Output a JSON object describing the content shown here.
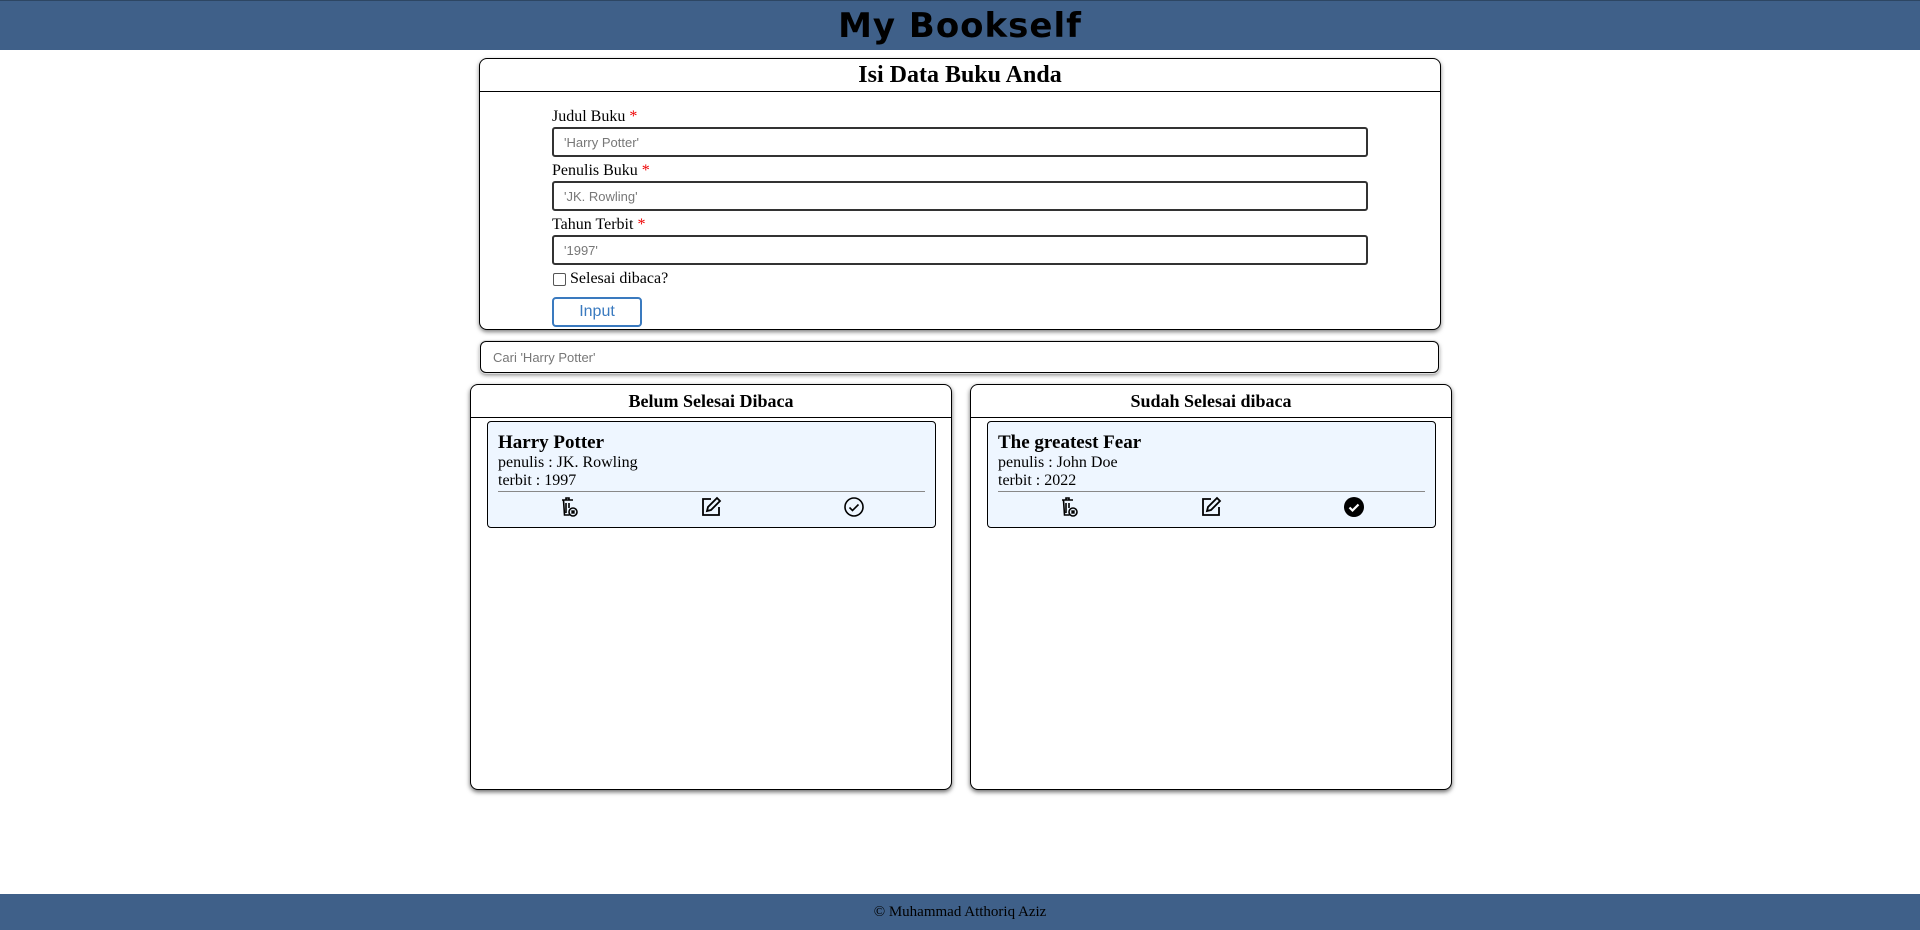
{
  "header": {
    "title": "My Bookself"
  },
  "form": {
    "title": "Isi Data Buku Anda",
    "title_field": {
      "label": "Judul Buku",
      "required_mark": "*",
      "placeholder": "'Harry Potter'"
    },
    "author_field": {
      "label": "Penulis Buku",
      "required_mark": "*",
      "placeholder": "'JK. Rowling'"
    },
    "year_field": {
      "label": "Tahun Terbit",
      "required_mark": "*",
      "placeholder": "'1997'"
    },
    "finished_checkbox": {
      "label": "Selesai dibaca?",
      "checked": false
    },
    "submit_label": "Input"
  },
  "search": {
    "placeholder": "Cari 'Harry Potter'"
  },
  "shelves": {
    "unfinished": {
      "title": "Belum Selesai Dibaca",
      "books": [
        {
          "title": "Harry Potter",
          "author": "penulis : JK. Rowling",
          "year": "terbit : 1997",
          "done": false
        }
      ]
    },
    "finished": {
      "title": "Sudah Selesai dibaca",
      "books": [
        {
          "title": "The greatest Fear",
          "author": "penulis : John Doe",
          "year": "terbit : 2022",
          "done": true
        }
      ]
    }
  },
  "icons": {
    "delete": "trash-icon",
    "edit": "edit-icon",
    "toggle_unfinished": "check-circle-outline-icon",
    "toggle_finished": "check-circle-filled-icon"
  },
  "footer": {
    "text": "© Muhammad Atthoriq Aziz"
  },
  "colors": {
    "header_bg": "#3f6089",
    "card_bg": "#eef6ff",
    "required": "#ee0000",
    "button_accent": "#3a7abf"
  }
}
